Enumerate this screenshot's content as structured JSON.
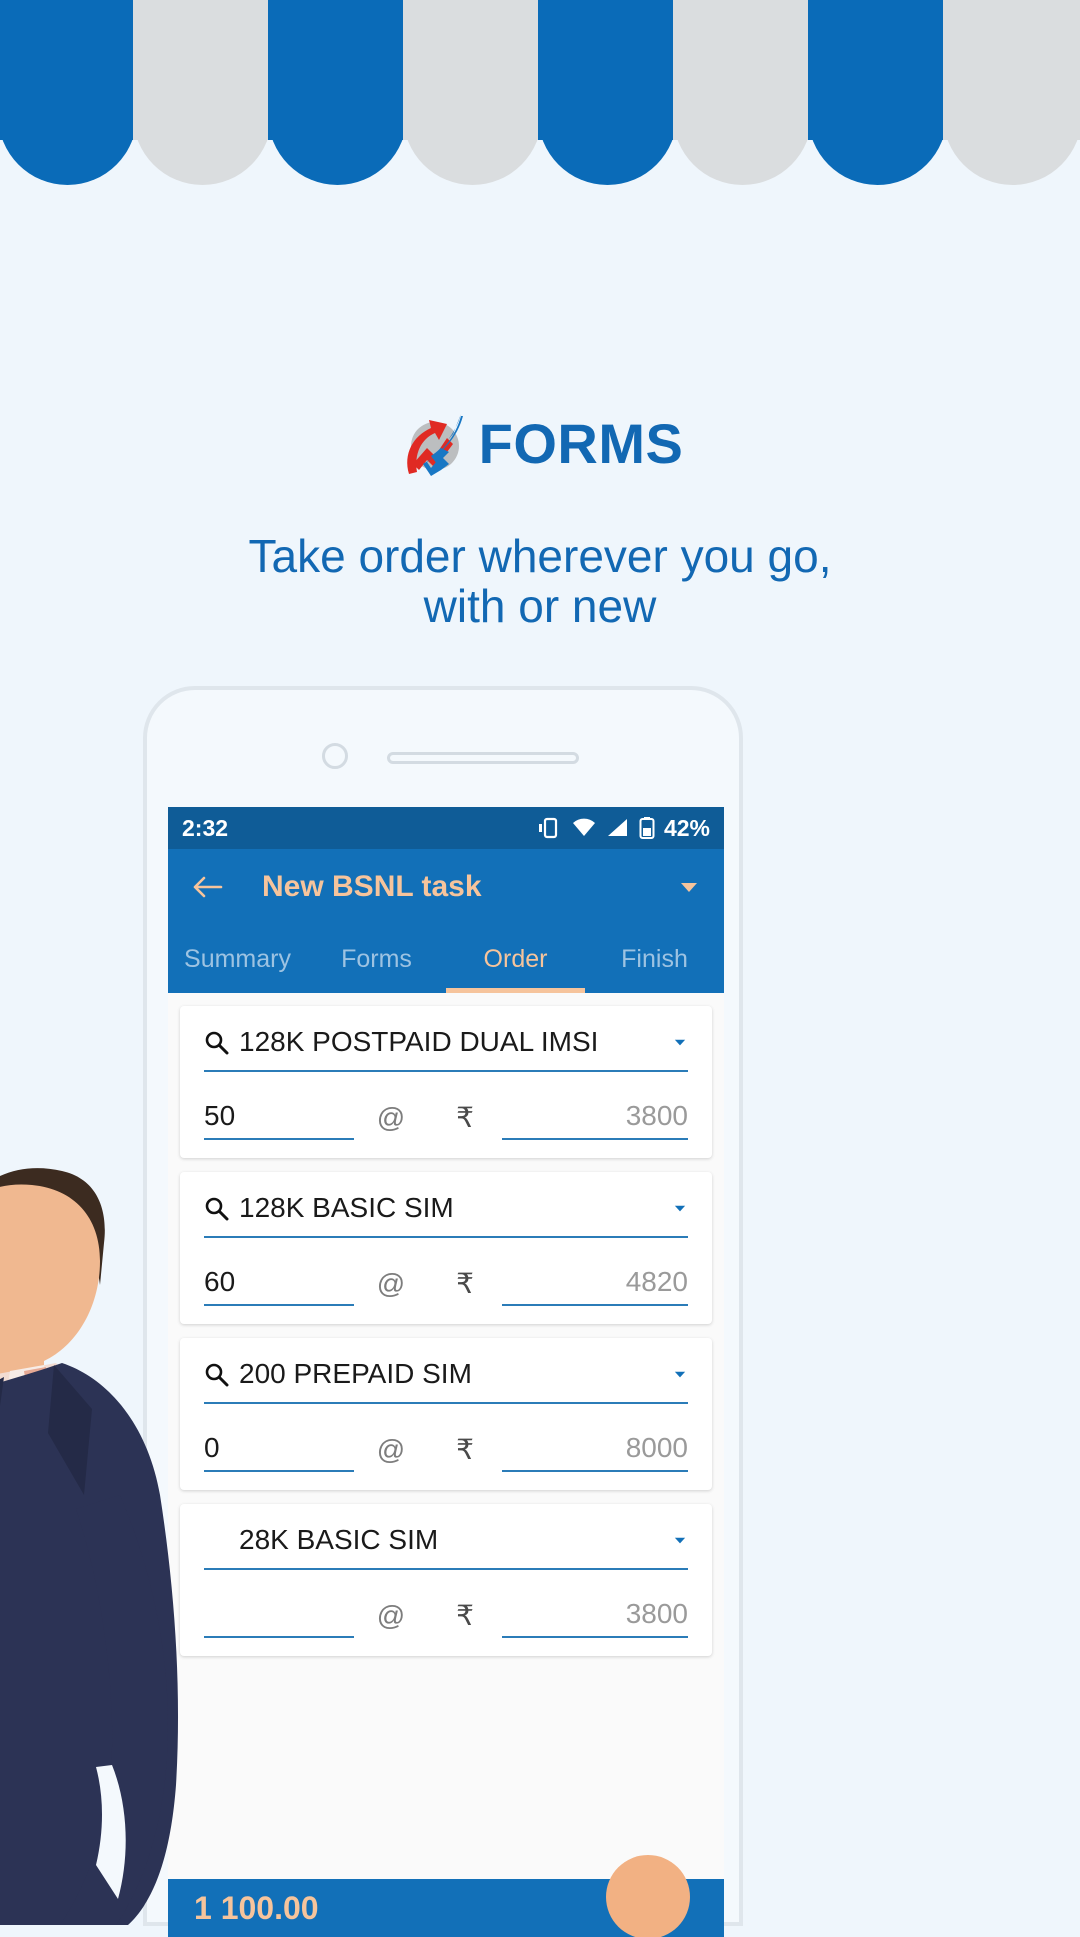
{
  "theme": {
    "page_bg": "#eff6fc",
    "awning_blue": "#0a6bb8",
    "awning_gray": "#dadddf",
    "brand_blue": "#1268b3",
    "appbar_blue": "#1270b8",
    "statusbar_blue": "#0f5c97",
    "accent_peach": "#f6c49c",
    "fab_peach": "#f2b183",
    "underline_blue": "#2b7cb8",
    "logo_red": "#e02a23",
    "logo_blue": "#1877c4",
    "logo_circle_gray": "#bcbec0"
  },
  "hero": {
    "brand_name": "FORMS",
    "brand_icon": "arrow-chart-logo-icon",
    "tagline_line1": "Take order wherever you go,",
    "tagline_line2": "with or new"
  },
  "phone": {
    "camera_icon": "camera-dot-icon",
    "speaker_icon": "earpiece-speaker-icon"
  },
  "app": {
    "statusbar": {
      "time": "2:32",
      "battery_pct": "42%",
      "icons": [
        "vibrate-icon",
        "wifi-icon",
        "signal-icon",
        "battery-icon"
      ]
    },
    "appbar": {
      "back_icon": "back-arrow-icon",
      "title": "New BSNL task",
      "overflow_icon": "chevron-down-icon"
    },
    "tabs": [
      {
        "label": "Summary",
        "active": false
      },
      {
        "label": "Forms",
        "active": false
      },
      {
        "label": "Order",
        "active": true
      },
      {
        "label": "Finish",
        "active": false
      }
    ],
    "order_rows": [
      {
        "search_icon": "search-icon",
        "item": "128K POSTPAID DUAL IMSI",
        "qty": "50",
        "at": "@",
        "currency": "₹",
        "price": "3800",
        "caret_icon": "chevron-down-icon"
      },
      {
        "search_icon": "search-icon",
        "item": "128K BASIC SIM",
        "qty": "60",
        "at": "@",
        "currency": "₹",
        "price": "4820",
        "caret_icon": "chevron-down-icon"
      },
      {
        "search_icon": "search-icon",
        "item": "200 PREPAID SIM",
        "qty": "0",
        "at": "@",
        "currency": "₹",
        "price": "8000",
        "caret_icon": "chevron-down-icon"
      },
      {
        "search_icon": "search-icon",
        "item": "28K BASIC SIM",
        "qty": "",
        "at": "@",
        "currency": "₹",
        "price": "3800",
        "caret_icon": "chevron-down-icon"
      }
    ],
    "bottombar": {
      "total": "1 100.00",
      "fab_icon": "add-fab-icon"
    }
  }
}
